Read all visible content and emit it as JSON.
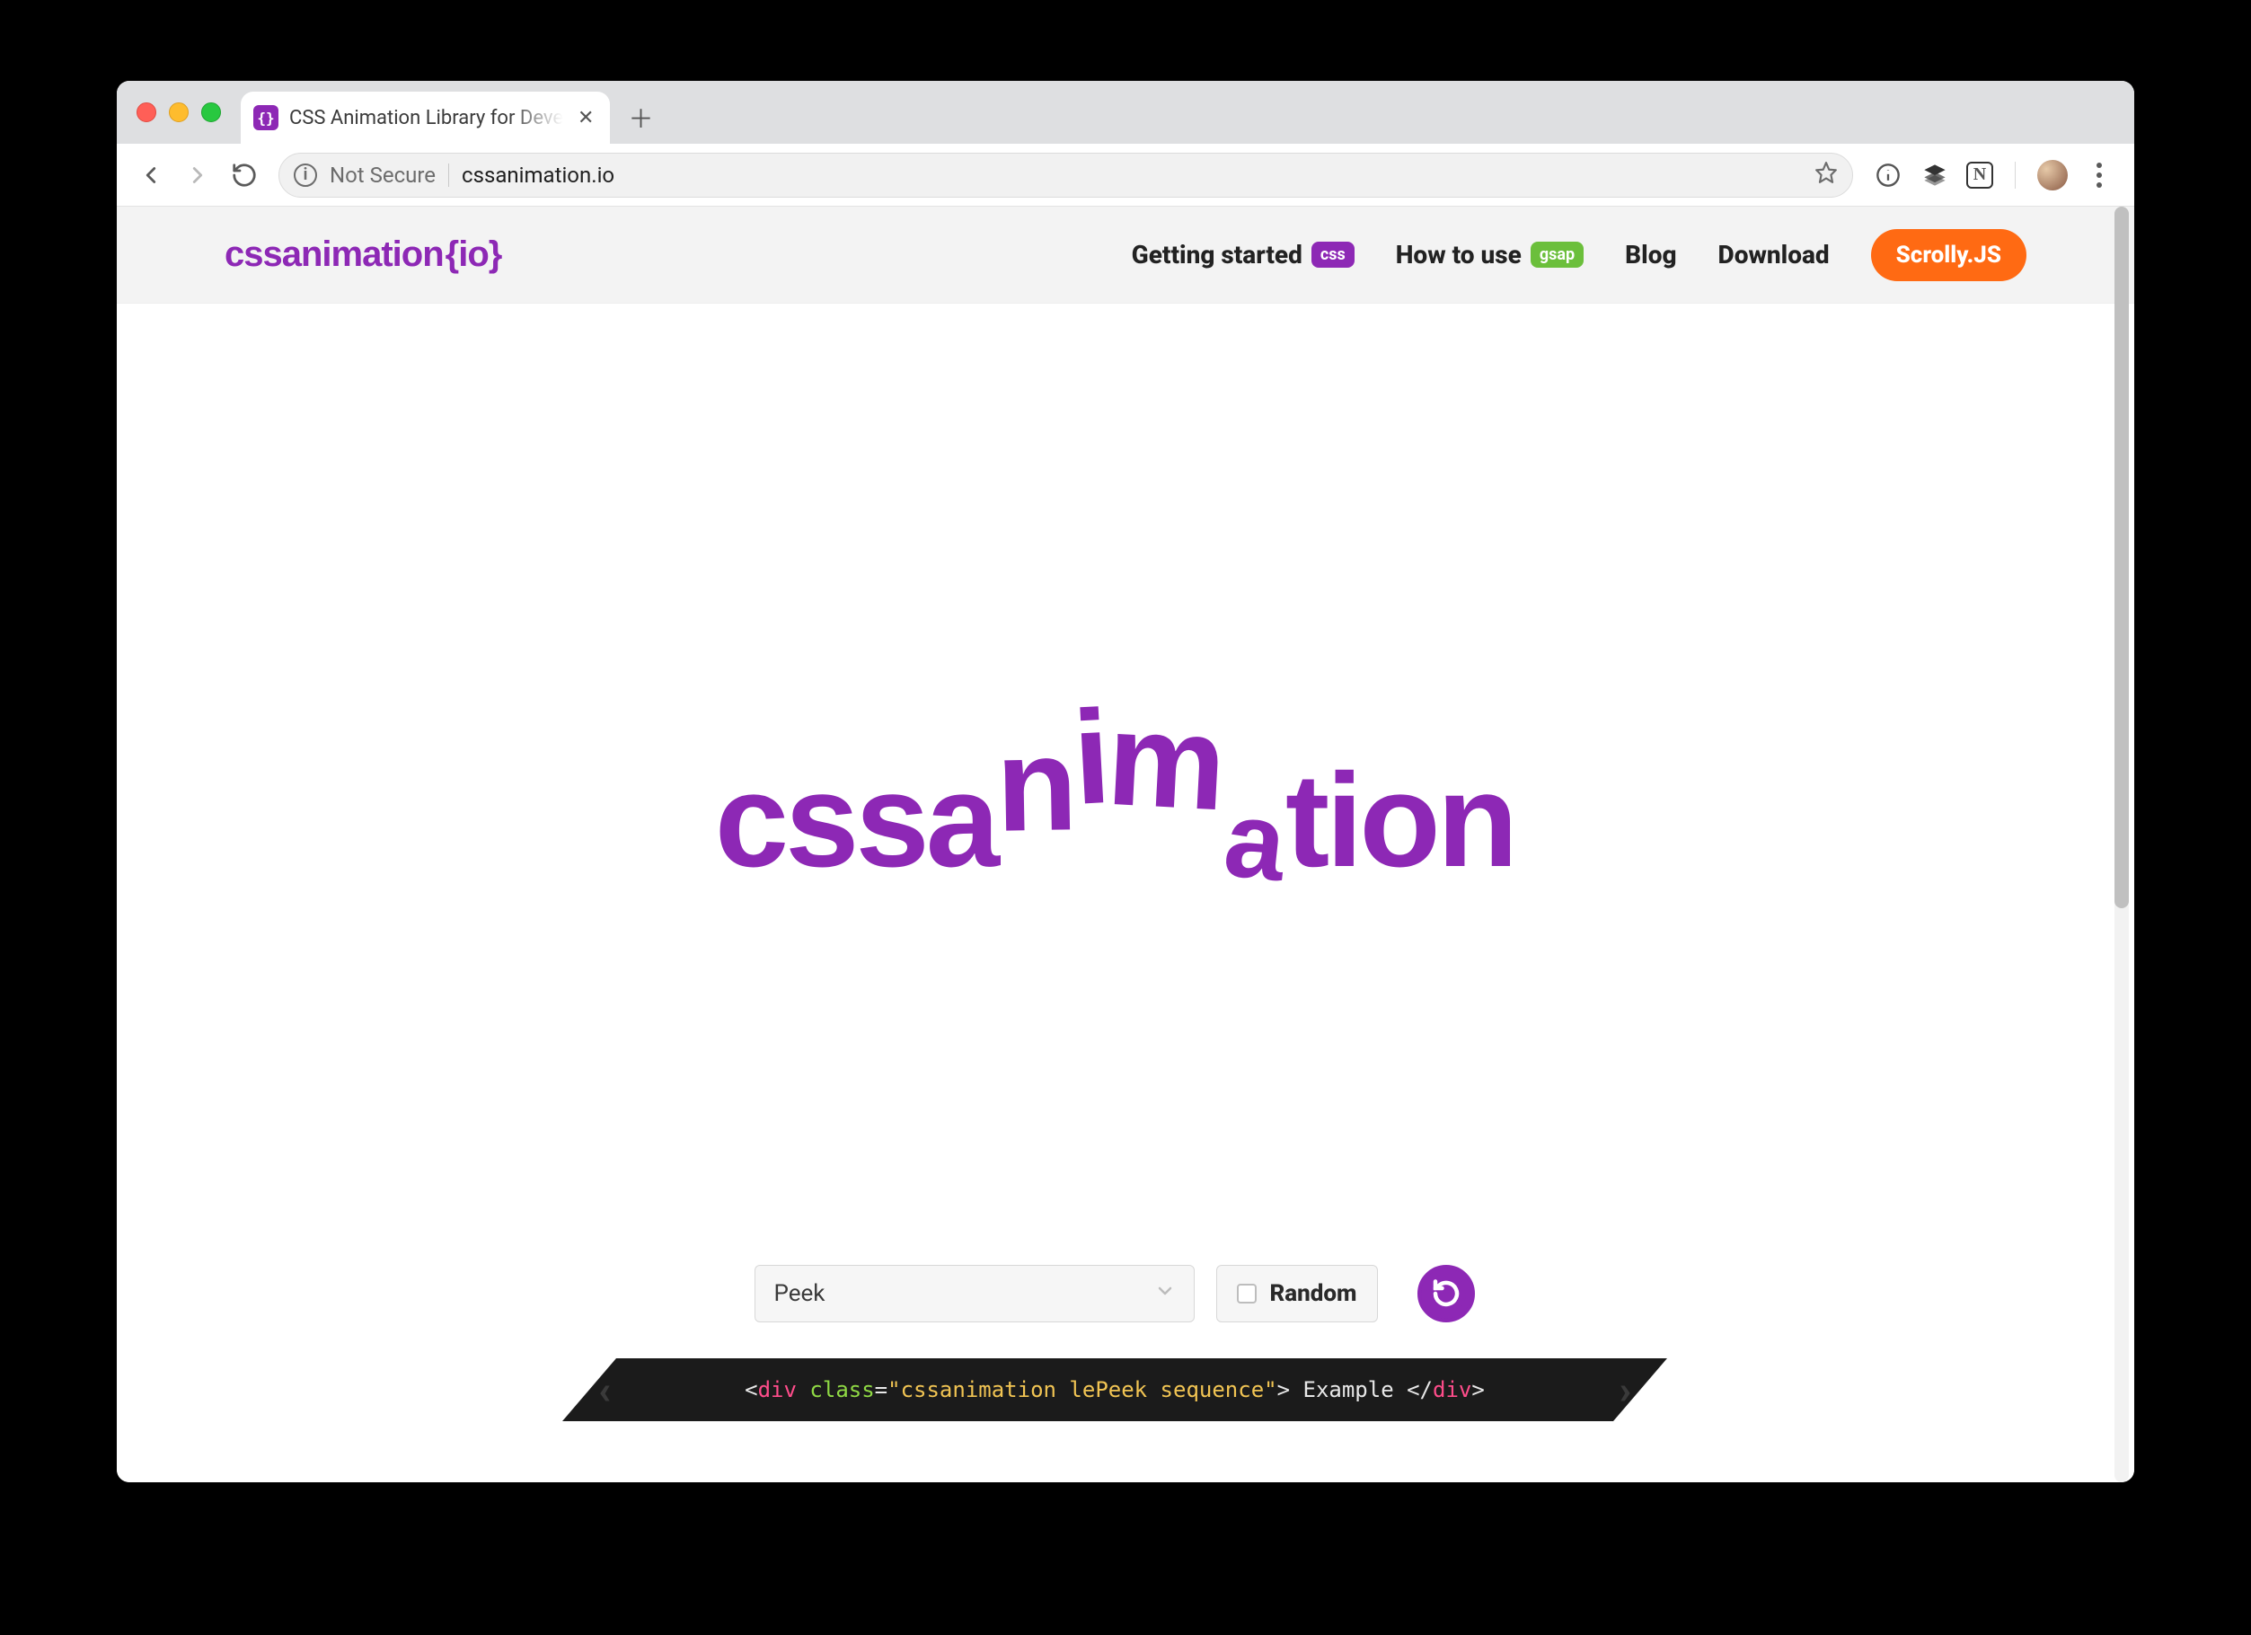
{
  "browser": {
    "tab_title": "CSS Animation Library for Deve",
    "security_label": "Not Secure",
    "url_host": "cssanimation.io"
  },
  "header": {
    "logo_main": "cssanimation",
    "logo_suffix": "{io}",
    "nav": {
      "getting_started": "Getting started",
      "getting_started_badge": "css",
      "how_to_use": "How to use",
      "how_to_use_badge": "gsap",
      "blog": "Blog",
      "download": "Download",
      "scrolly": "Scrolly.JS"
    }
  },
  "hero": {
    "letters": [
      "c",
      "s",
      "s",
      "a",
      "n",
      "i",
      "m",
      "a",
      "t",
      "i",
      "o",
      "n"
    ]
  },
  "controls": {
    "select_value": "Peek",
    "random_label": "Random"
  },
  "code": {
    "open_angle": "<",
    "tag": "div",
    "space1": " ",
    "attr": "class",
    "eq": "=",
    "str": "\"cssanimation lePeek sequence\"",
    "close_angle": ">",
    "text": " Example ",
    "open_angle2": "</",
    "tag2": "div",
    "close_angle2": ">"
  }
}
